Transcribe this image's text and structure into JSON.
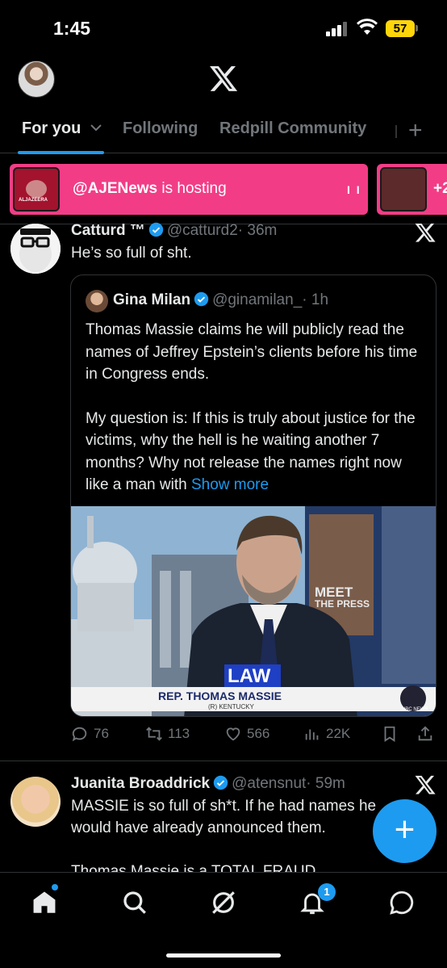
{
  "status": {
    "time": "1:45",
    "battery": "57"
  },
  "tabs": [
    {
      "label": "For you"
    },
    {
      "label": "Following"
    },
    {
      "label": "Redpill Community"
    }
  ],
  "spaces": {
    "host_handle": "@AJENews",
    "host_suffix": " is hosting",
    "host_logo": "ALJAZEERA",
    "extra_count": "+2"
  },
  "tweet1": {
    "name": "Catturd ™",
    "handle": "@catturd2",
    "time": "· 36m",
    "text": "He’s so full of sht.",
    "quote": {
      "name": "Gina Milan",
      "handle": "@ginamilan_",
      "time": "· 1h",
      "text_p1": "Thomas Massie claims he will publicly read the names of Jeffrey Epstein’s clients before his time in Congress ends.",
      "text_p2": "My question is: If this is truly about justice for the victims, why the hell is he waiting another 7 months? Why not release the names right now like a man with ",
      "show_more": "Show more",
      "image": {
        "chyron_top": "LAW",
        "chyron_name": "REP. THOMAS MASSIE",
        "chyron_sub": "(R) KENTUCKY",
        "show_logo_1": "MEET",
        "show_logo_2": "THE PRESS",
        "network": "NBC NEWS"
      }
    },
    "stats": {
      "replies": "76",
      "reposts": "113",
      "likes": "566",
      "views": "22K"
    }
  },
  "tweet2": {
    "name": "Juanita Broaddrick",
    "handle": "@atensnut",
    "time": "· 59m",
    "line1": "MASSIE is so full of sh*t.  If he had names he",
    "line2": "would have already announced them.",
    "line3": "Thomas Massie is a TOTAL FRAUD"
  },
  "bottom_nav": {
    "notifications_badge": "1"
  },
  "colors": {
    "accent": "#1d9bf0",
    "spaces": "#f23d86",
    "battery": "#ffd60a"
  }
}
